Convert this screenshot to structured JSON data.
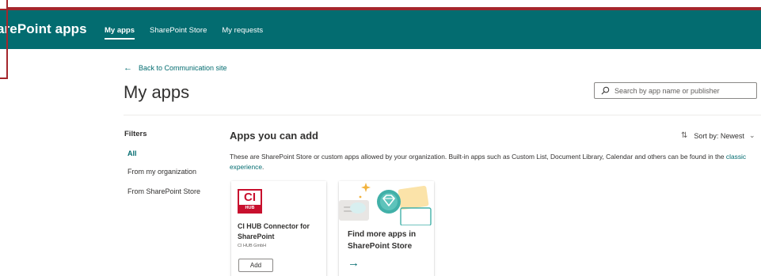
{
  "header": {
    "brand": "arePoint apps",
    "nav": [
      {
        "label": "My apps",
        "active": true
      },
      {
        "label": "SharePoint Store",
        "active": false
      },
      {
        "label": "My requests",
        "active": false
      }
    ],
    "color": "#036c70"
  },
  "back_link": {
    "label": "Back to Communication site",
    "icon": "arrow-left-icon"
  },
  "page_title": "My apps",
  "search": {
    "placeholder": "Search by app name or publisher",
    "value": ""
  },
  "filters": {
    "title": "Filters",
    "items": [
      "All",
      "From my organization",
      "From SharePoint Store"
    ],
    "selected": "All"
  },
  "apps_section": {
    "title": "Apps you can add",
    "sort_label": "Sort by:",
    "sort_value": "Newest",
    "description_before": "These are SharePoint Store or custom apps allowed by your organization. Built-in apps such as Custom List, Document Library, Calendar and others can be found in the",
    "description_link": "classic experience",
    "description_after": "."
  },
  "cards": [
    {
      "logo_text": "CI",
      "logo_subtext": "HUB",
      "name": "CI HUB Connector for SharePoint",
      "publisher": "CI HUB GmbH",
      "button": "Add"
    },
    {
      "name": "Find more apps in SharePoint Store"
    }
  ],
  "colors": {
    "accent": "#036c70",
    "logo_red": "#c8102e"
  }
}
